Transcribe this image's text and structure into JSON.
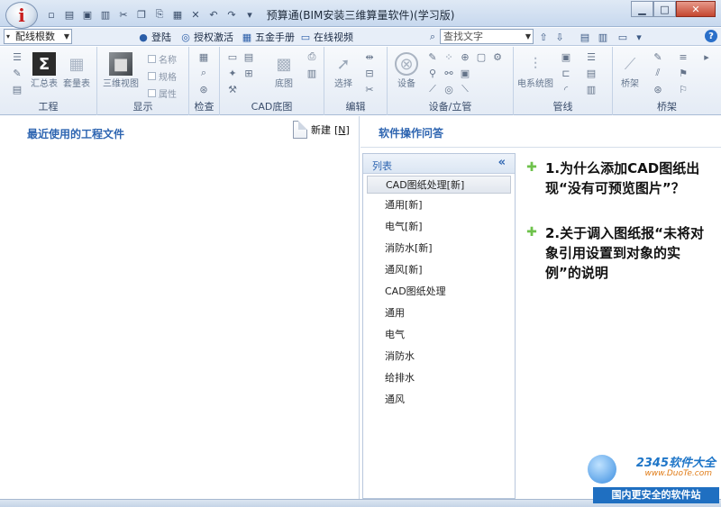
{
  "window": {
    "title": "预算通(BIM安装三维算量软件)(学习版)",
    "app_icon_letter": "i",
    "min_glyph": "▁",
    "max_glyph": "□",
    "close_glyph": "✕"
  },
  "toolbar2": {
    "combo_value": "配线根数",
    "login_label": "登陆",
    "activate_label": "授权激活",
    "manual_label": "五金手册",
    "video_label": "在线视频",
    "search_placeholder": "查找文字",
    "help_glyph": "?"
  },
  "ribbon": {
    "groups": [
      {
        "label": "工程"
      },
      {
        "label": "显示"
      },
      {
        "label": "检查"
      },
      {
        "label": "CAD底图"
      },
      {
        "label": "编辑"
      },
      {
        "label": "设备/立管"
      },
      {
        "label": "管线"
      },
      {
        "label": "桥架"
      }
    ],
    "buttons": {
      "summary": "汇总表",
      "quantity": "套量表",
      "view3d": "三维视图",
      "cad_base": "底图",
      "select": "选择",
      "device": "设备",
      "elec_pipe": "电系统图",
      "tray": "桥架"
    },
    "checkboxes": [
      "名称",
      "规格",
      "属性"
    ]
  },
  "left_pane": {
    "title": "最近使用的工程文件",
    "new_label": "新建",
    "new_shortcut": "[N]"
  },
  "faq": {
    "title": "软件操作问答",
    "list_header": "列表",
    "collapse_glyph": "«",
    "categories": [
      "CAD图纸处理[新]",
      "通用[新]",
      "电气[新]",
      "消防水[新]",
      "通风[新]",
      "CAD图纸处理",
      "通用",
      "电气",
      "消防水",
      "给排水",
      "通风"
    ],
    "questions": [
      "1.为什么添加CAD图纸出现“没有可预览图片”？",
      "2.关于调入图纸报“未将对象引用设置到对象的实例”的说明"
    ]
  },
  "watermark": {
    "logo": "2345软件大全",
    "url": "www.DuoTe.com",
    "tag": "国内更安全的软件站"
  }
}
